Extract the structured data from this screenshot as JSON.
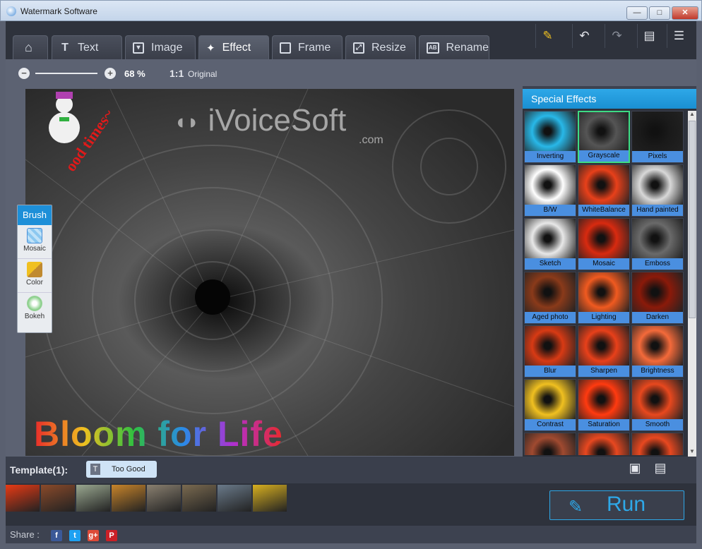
{
  "window": {
    "title": "Watermark Software",
    "minimize": "—",
    "maximize": "□",
    "close": "✕"
  },
  "tabs": [
    {
      "label": "",
      "icon": "home-icon"
    },
    {
      "label": "Text",
      "icon": "text-icon"
    },
    {
      "label": "Image",
      "icon": "image-icon"
    },
    {
      "label": "Effect",
      "icon": "effect-icon",
      "active": true
    },
    {
      "label": "Frame",
      "icon": "frame-icon"
    },
    {
      "label": "Resize",
      "icon": "resize-icon"
    },
    {
      "label": "Rename",
      "icon": "rename-icon"
    }
  ],
  "toolbar": {
    "buttons": [
      {
        "icon": "pin-icon"
      },
      {
        "icon": "undo-icon"
      },
      {
        "icon": "redo-icon"
      },
      {
        "icon": "chat-icon"
      },
      {
        "icon": "list-icon"
      }
    ]
  },
  "zoom": {
    "percent": "68 %",
    "percent_value": 0.68,
    "ratio_label": "1:1",
    "original_label": "Original"
  },
  "canvas": {
    "watermark_text": "iVoiceSoft",
    "watermark_sub": ".com",
    "bottom_text": "Bloom for Life",
    "sticker_text": "ood times~"
  },
  "brush": {
    "title": "Brush",
    "items": [
      {
        "label": "Mosaic",
        "icon": "mosaic-icon"
      },
      {
        "label": "Color",
        "icon": "paintbrush-icon"
      },
      {
        "label": "Bokeh",
        "icon": "bokeh-icon"
      }
    ]
  },
  "effects_panel": {
    "title": "Special Effects",
    "items": [
      {
        "label": "Inverting",
        "color": "#28b8e8"
      },
      {
        "label": "Grayscale",
        "color": "#555555",
        "selected": true
      },
      {
        "label": "Pixels",
        "color": "#1a1a1a"
      },
      {
        "label": "B/W",
        "color": "#ffffff"
      },
      {
        "label": "WhiteBalance",
        "color": "#e8401a"
      },
      {
        "label": "Hand painted",
        "color": "#d8d8d8"
      },
      {
        "label": "Sketch",
        "color": "#e8e8e8"
      },
      {
        "label": "Mosaic",
        "color": "#d82a10"
      },
      {
        "label": "Emboss",
        "color": "#6a6a6a"
      },
      {
        "label": "Aged photo",
        "color": "#8a3a1a"
      },
      {
        "label": "Lighting",
        "color": "#f05a20"
      },
      {
        "label": "Darken",
        "color": "#8a1a0a"
      },
      {
        "label": "Blur",
        "color": "#d83a14"
      },
      {
        "label": "Sharpen",
        "color": "#e8401a"
      },
      {
        "label": "Brightness",
        "color": "#f46a3a"
      },
      {
        "label": "Contrast",
        "color": "#f0c020"
      },
      {
        "label": "Saturation",
        "color": "#ff3a10"
      },
      {
        "label": "Smooth",
        "color": "#e8481e"
      },
      {
        "label": "",
        "color": "#a04a30"
      },
      {
        "label": "",
        "color": "#e84820"
      },
      {
        "label": "",
        "color": "#e84820"
      }
    ]
  },
  "template": {
    "label": "Template(1):",
    "chip_icon": "T",
    "chip_text": "Too Good"
  },
  "thumbnails": [
    {
      "name": "flower",
      "color": "#e83a14"
    },
    {
      "name": "desert",
      "color": "#8a4a2a"
    },
    {
      "name": "hydrangea",
      "color": "#9aa890"
    },
    {
      "name": "jellyfish",
      "color": "#c8842a"
    },
    {
      "name": "koala",
      "color": "#8a8070"
    },
    {
      "name": "lighthouse",
      "color": "#7a6a50"
    },
    {
      "name": "penguins",
      "color": "#6a7a8a"
    },
    {
      "name": "tulips",
      "color": "#d8b020"
    }
  ],
  "run_button": {
    "label": "Run"
  },
  "share": {
    "label": "Share :",
    "networks": [
      {
        "name": "facebook",
        "glyph": "f",
        "color": "#3b5998"
      },
      {
        "name": "twitter",
        "glyph": "t",
        "color": "#1da1f2"
      },
      {
        "name": "googleplus",
        "glyph": "g+",
        "color": "#dd4b39"
      },
      {
        "name": "pinterest",
        "glyph": "P",
        "color": "#cb2027"
      }
    ]
  }
}
